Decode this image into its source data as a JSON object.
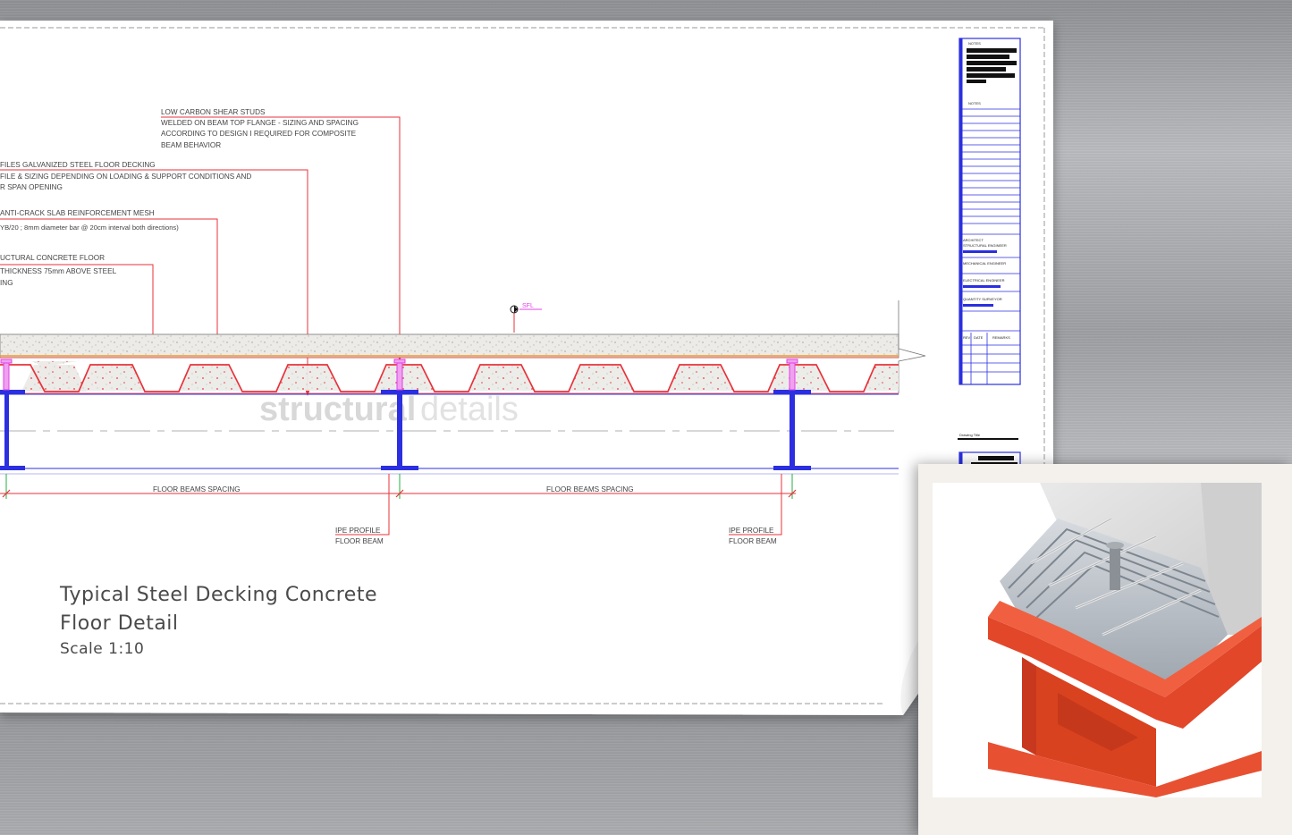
{
  "drawing": {
    "labels": {
      "studs_1": "LOW CARBON SHEAR STUDS",
      "studs_2": "WELDED ON BEAM TOP FLANGE - SIZING AND SPACING",
      "studs_3": "ACCORDING TO DESIGN I REQUIRED FOR COMPOSITE",
      "studs_4": "BEAM BEHAVIOR",
      "decking_1": "FILES GALVANIZED STEEL FLOOR DECKING",
      "decking_2": "FILE & SIZING DEPENDING ON LOADING & SUPPORT CONDITIONS AND",
      "decking_3": "R SPAN OPENING",
      "mesh_1": "ANTI-CRACK SLAB REINFORCEMENT MESH",
      "mesh_2": "YB/20 ; 8mm diameter bar @ 20cm interval both directions)",
      "concrete_1": "UCTURAL CONCRETE FLOOR",
      "concrete_2": "THICKNESS 75mm ABOVE STEEL",
      "concrete_3": "ING",
      "sfl": "SFL",
      "spacing_left": "FLOOR BEAMS SPACING",
      "spacing_right": "FLOOR BEAMS SPACING",
      "ipe_mid_1": "IPE PROFILE",
      "ipe_mid_2": "FLOOR BEAM",
      "ipe_right_1": "IPE PROFILE",
      "ipe_right_2": "FLOOR BEAM",
      "watermark_bold": "structural",
      "watermark_light": "details"
    },
    "title_block": {
      "notes_1": "NOTES",
      "notes_2": "NOTES",
      "architect": "ARCHITECT",
      "structural": "STRUCTURAL ENGINEER",
      "mechanical": "MECHANICAL ENGINEER",
      "electrical": "ELECTRICAL ENGINEER",
      "quantity": "QUANTITY SURVEYOR",
      "rev_1": "REV",
      "rev_2": "DATE",
      "rev_3": "REMARKS",
      "drawing_title": "Drawing Title"
    },
    "colors": {
      "red": "#e8323a",
      "blue": "#2b2fe0",
      "magenta": "#e040e6",
      "green": "#20b040"
    }
  },
  "caption": {
    "title_line_1": "Typical Steel Decking Concrete",
    "title_line_2": "Floor Detail",
    "scale": "Scale 1:10"
  },
  "photo": {
    "subject_icon": "steel-deck-beam-illustration"
  }
}
